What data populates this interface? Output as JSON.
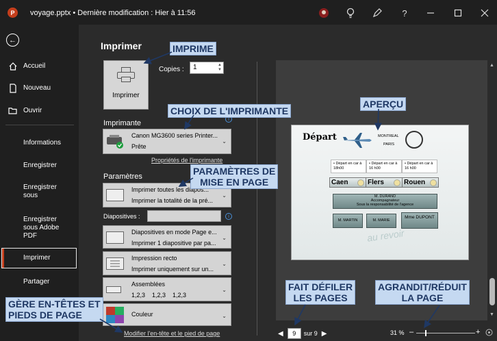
{
  "window": {
    "app_icon": "P",
    "title": "voyage.pptx • Dernière modification : Hier à 11:56",
    "icons": [
      "avatar-icon",
      "lightbulb-icon",
      "pen-icon",
      "help-icon",
      "minimize-icon",
      "maximize-icon",
      "close-icon"
    ],
    "help": "?"
  },
  "sidebar": {
    "back_icon": "back-arrow-icon",
    "items": [
      {
        "label": "Accueil",
        "icon": "home-icon"
      },
      {
        "label": "Nouveau",
        "icon": "new-document-icon"
      },
      {
        "label": "Ouvrir",
        "icon": "folder-open-icon"
      },
      {
        "label": "Informations"
      },
      {
        "label": "Enregistrer"
      },
      {
        "label": "Enregistrer\nsous"
      },
      {
        "label": "Enregistrer\nsous Adobe\nPDF"
      },
      {
        "label": "Imprimer"
      },
      {
        "label": "Partager"
      }
    ],
    "active": "Imprimer"
  },
  "print": {
    "heading": "Imprimer",
    "print_button": "Imprimer",
    "copies_label": "Copies :",
    "copies_value": "1",
    "printer_section": "Imprimante",
    "printer_name": "Canon MG3600 series Printer...",
    "printer_status": "Prête",
    "printer_properties": "Propriétés de l'imprimante",
    "settings_section": "Paramètres",
    "range_l1": "Imprimer toutes les diapos...",
    "range_l2": "Imprimer la totalité de la pré...",
    "slides_label": "Diapositives :",
    "slides_value": "",
    "layout_l1": "Diapositives en mode Page e...",
    "layout_l2": "Imprimer 1 diapositive par pa...",
    "sides_l1": "Impression recto",
    "sides_l2": "Imprimer uniquement sur un...",
    "collate_l1": "Assemblées",
    "collate_l2": "1,2,3    1,2,3    1,2,3",
    "color_l1": "Couleur",
    "header_footer_link": "Modifier l'en-tête et le pied de page"
  },
  "preview": {
    "slide": {
      "title": "Départ",
      "city_a": "MONTREAL",
      "city_b": "PARIS",
      "departures": [
        "• Départ en car à 18h00",
        "• Départ en car à 16 h00",
        "• Départ en car à 16 h00"
      ],
      "cities": [
        "Caen",
        "Flers",
        "Rouen"
      ],
      "organizer_name": "M. DURAND",
      "organizer_role": "Accompagnateur",
      "organizer_note": "Sous la responsabilité de l'agence",
      "people": [
        "M. MARTIN",
        "M. MARIE",
        "Mme DUPONT"
      ],
      "farewell": "au revoir"
    },
    "page_value": "9",
    "page_of": "sur 9",
    "zoom": "31 %",
    "zoom_minus": "–",
    "zoom_plus": "+",
    "zoom_level_percent": 31
  },
  "callouts": {
    "imprime": "IMPRIME",
    "printer": "CHOIX DE L'IMPRIMANTE",
    "settings": "PARAMÈTRES DE\nMISE EN PAGE",
    "preview": "APERÇU",
    "headers": "GÈRE EN-TÊTES ET\nPIEDS DE PAGE",
    "pages": "FAIT DÉFILER\nLES PAGES",
    "zoom": "AGRANDIT/RÉDUIT\nLA PAGE"
  },
  "colors": {
    "accent": "#c43e1c",
    "callout_bg": "#c5d9f1",
    "callout_text": "#1f3864",
    "arrow": "#1f3864"
  }
}
